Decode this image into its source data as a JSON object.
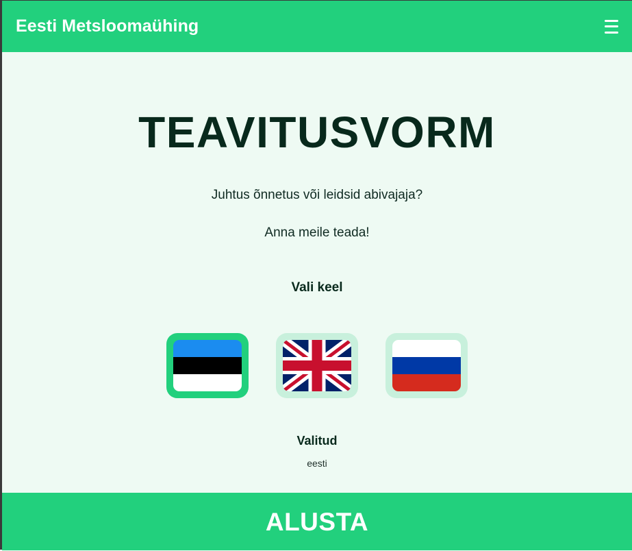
{
  "header": {
    "brand": "Eesti Metsloomaühing",
    "menu_icon": "hamburger-menu-icon"
  },
  "main": {
    "title": "TEAVITUSVORM",
    "subtitle_1": "Juhtus õnnetus või leidsid abivajaja?",
    "subtitle_2": "Anna meile teada!",
    "language_prompt": "Vali keel",
    "languages": [
      {
        "code": "et",
        "flag": "estonia-flag-icon",
        "selected": true
      },
      {
        "code": "en",
        "flag": "uk-flag-icon",
        "selected": false
      },
      {
        "code": "ru",
        "flag": "russia-flag-icon",
        "selected": false
      }
    ],
    "selected_label": "Valitud",
    "selected_value": "eesti"
  },
  "footer": {
    "start_label": "ALUSTA"
  },
  "colors": {
    "accent": "#22d07d",
    "background": "#eefaf3",
    "chip_unselected": "#c8f0dc",
    "text_dark": "#08291c"
  }
}
